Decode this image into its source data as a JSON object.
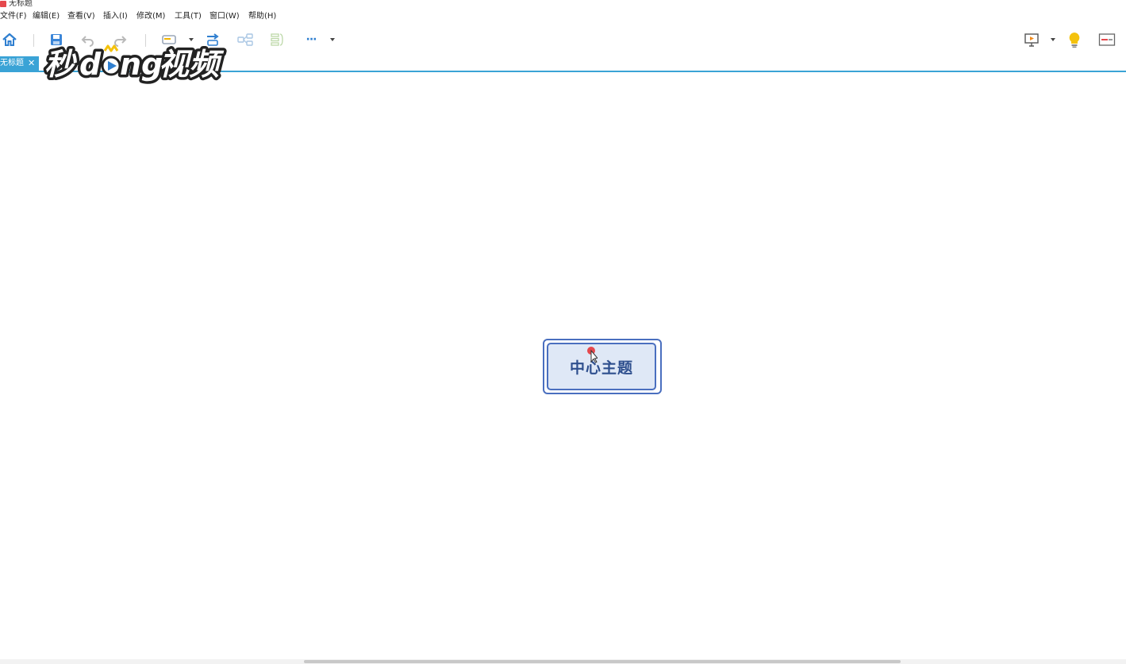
{
  "window": {
    "title": "无标题"
  },
  "menu": [
    "文件(F)",
    "编辑(E)",
    "查看(V)",
    "插入(I)",
    "修改(M)",
    "工具(T)",
    "窗口(W)",
    "帮助(H)"
  ],
  "toolbar": {
    "buttons": [
      "home-icon",
      "save-icon",
      "undo-icon",
      "redo-icon",
      "topic-icon",
      "subtopic-icon",
      "floating-topic-icon",
      "summary-icon",
      "more-icon"
    ],
    "more_label": "···",
    "right_buttons": [
      "presentation-icon",
      "idea-bulb-icon",
      "panel-toggle-icon"
    ]
  },
  "tabs": [
    {
      "label": "无标题",
      "close": "✕"
    }
  ],
  "canvas": {
    "central_topic": "中心主题"
  },
  "colors": {
    "accent": "#3aa3d6",
    "topic_border": "#4a6fbf",
    "topic_fill": "#dfe8f6",
    "topic_text": "#2e4f8e",
    "app_icon": "#e5484d",
    "bulb": "#f4c20d"
  }
}
